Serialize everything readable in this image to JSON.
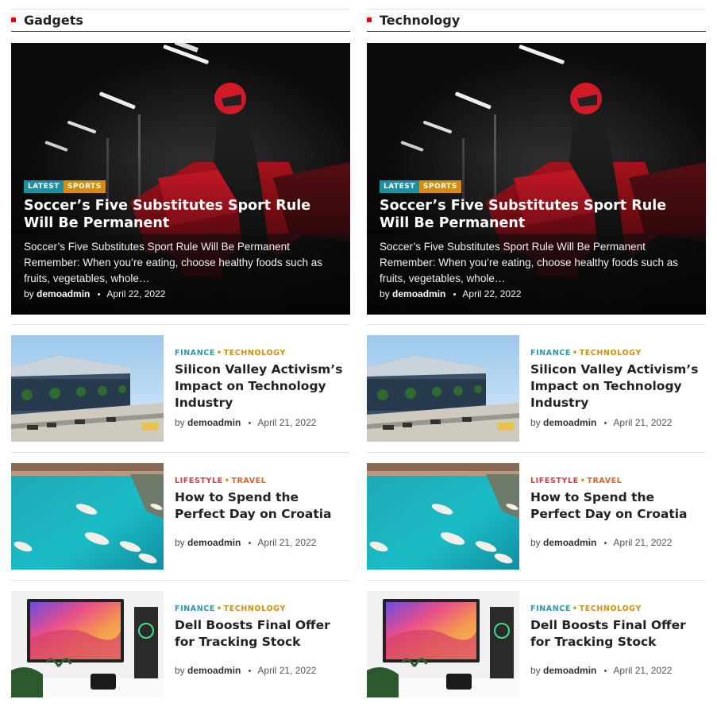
{
  "sections": [
    {
      "title": "Gadgets",
      "featured": {
        "badges": [
          "LATEST",
          "SPORTS"
        ],
        "title": "Soccer’s Five Substitutes Sport Rule Will Be Permanent",
        "excerpt": "Soccer’s Five Substitutes Sport Rule Will Be Permanent Remember: When you’re eating, choose healthy foods such as fruits, vegetables, whole…",
        "by": "by",
        "author": "demoadmin",
        "date": "April 22, 2022"
      },
      "posts": [
        {
          "cat1": "FINANCE",
          "cat2": "TECHNOLOGY",
          "title": "Silicon Valley Activism’s Impact on Technology Industry",
          "by": "by",
          "author": "demoadmin",
          "date": "April 21, 2022"
        },
        {
          "cat1": "LIFESTYLE",
          "cat2": "TRAVEL",
          "title": "How to Spend the Perfect Day on Croatia",
          "by": "by",
          "author": "demoadmin",
          "date": "April 21, 2022"
        },
        {
          "cat1": "FINANCE",
          "cat2": "TECHNOLOGY",
          "title": "Dell Boosts Final Offer for Tracking Stock",
          "by": "by",
          "author": "demoadmin",
          "date": "April 21, 2022"
        }
      ]
    },
    {
      "title": "Technology",
      "featured": {
        "badges": [
          "LATEST",
          "SPORTS"
        ],
        "title": "Soccer’s Five Substitutes Sport Rule Will Be Permanent",
        "excerpt": "Soccer’s Five Substitutes Sport Rule Will Be Permanent Remember: When you’re eating, choose healthy foods such as fruits, vegetables, whole…",
        "by": "by",
        "author": "demoadmin",
        "date": "April 22, 2022"
      },
      "posts": [
        {
          "cat1": "FINANCE",
          "cat2": "TECHNOLOGY",
          "title": "Silicon Valley Activism’s Impact on Technology Industry",
          "by": "by",
          "author": "demoadmin",
          "date": "April 21, 2022"
        },
        {
          "cat1": "LIFESTYLE",
          "cat2": "TRAVEL",
          "title": "How to Spend the Perfect Day on Croatia",
          "by": "by",
          "author": "demoadmin",
          "date": "April 21, 2022"
        },
        {
          "cat1": "FINANCE",
          "cat2": "TECHNOLOGY",
          "title": "Dell Boosts Final Offer for Tracking Stock",
          "by": "by",
          "author": "demoadmin",
          "date": "April 21, 2022"
        }
      ]
    }
  ],
  "separator": "•",
  "colors": {
    "accent": "#c90000",
    "badge_latest": "#1d8fa5",
    "badge_sports": "#d38e12",
    "cat_finance": "#2a9aa8",
    "cat_technology": "#d38e12",
    "cat_lifestyle": "#d53c3c",
    "cat_travel": "#e3631b"
  }
}
